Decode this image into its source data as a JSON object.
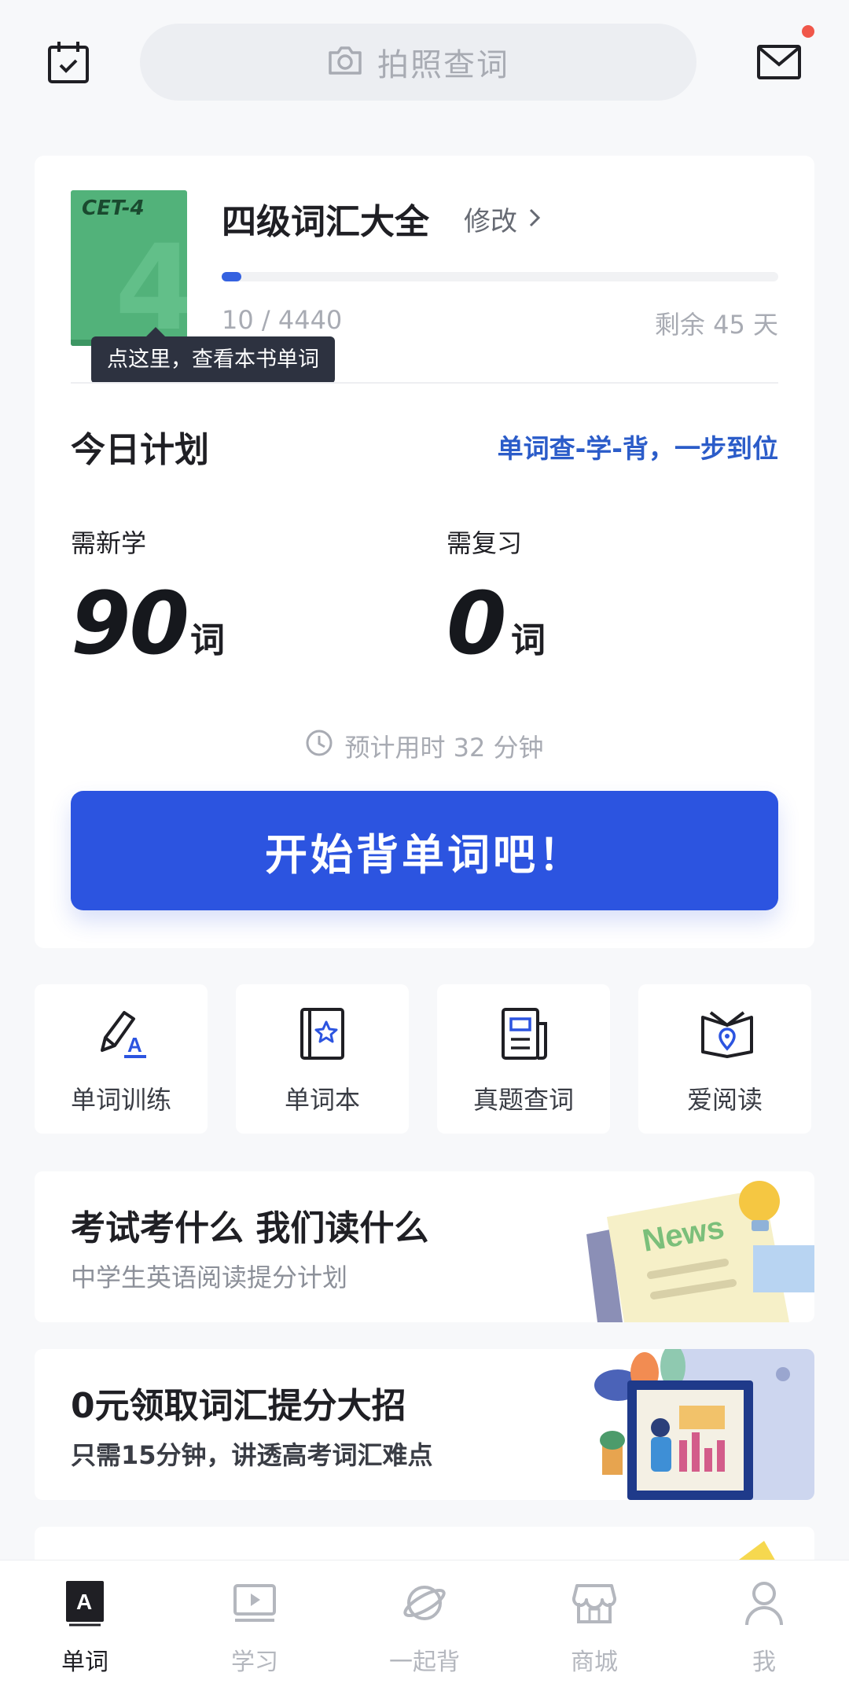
{
  "header": {
    "search_label": "拍照查词",
    "icons": {
      "calendar": "calendar-check-icon",
      "search": "camera-icon",
      "mail": "mail-icon"
    },
    "has_unread": true
  },
  "book": {
    "cover_label": "CET-4",
    "cover_number": "4",
    "cover_color": "#52b27a",
    "title": "四级词汇大全",
    "edit_label": "修改",
    "learned": 10,
    "total": 4440,
    "progress_text": "10 / 4440",
    "days_left_text": "剩余 45 天",
    "tooltip": "点这里，查看本书单词"
  },
  "plan": {
    "title": "今日计划",
    "slogan": "单词查-学-背，一步到位",
    "new_label": "需新学",
    "new_count": "90",
    "review_label": "需复习",
    "review_count": "0",
    "unit": "词",
    "estimate": "预计用时 32 分钟",
    "start_button": "开始背单词吧！"
  },
  "tools": [
    {
      "label": "单词训练",
      "icon": "pencil-a-icon"
    },
    {
      "label": "单词本",
      "icon": "star-book-icon"
    },
    {
      "label": "真题查词",
      "icon": "newspaper-icon"
    },
    {
      "label": "爱阅读",
      "icon": "open-book-pin-icon"
    }
  ],
  "banners": [
    {
      "title": "考试考什么 我们读什么",
      "subtitle": "中学生英语阅读提分计划",
      "art_text": "News"
    },
    {
      "title": "0元领取词汇提分大招",
      "subtitle": "只需15分钟，讲透高考词汇难点"
    }
  ],
  "nav": [
    {
      "label": "单词",
      "icon": "word-a-icon",
      "active": true
    },
    {
      "label": "学习",
      "icon": "video-icon",
      "active": false
    },
    {
      "label": "一起背",
      "icon": "planet-icon",
      "active": false
    },
    {
      "label": "商城",
      "icon": "store-icon",
      "active": false
    },
    {
      "label": "我",
      "icon": "person-icon",
      "active": false
    }
  ],
  "colors": {
    "accent": "#2c54e0",
    "slogan": "#2b5cc9",
    "notification": "#f0574a",
    "bg": "#f7f8fa"
  }
}
